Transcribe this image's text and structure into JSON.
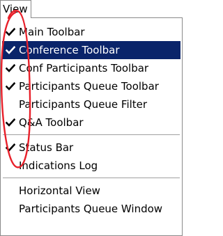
{
  "menu": {
    "title": "View",
    "sections": [
      [
        {
          "label": "Main Toolbar",
          "checked": true,
          "selected": false
        },
        {
          "label": "Conference Toolbar",
          "checked": true,
          "selected": true
        },
        {
          "label": "Conf Participants Toolbar",
          "checked": true,
          "selected": false
        },
        {
          "label": "Participants Queue Toolbar",
          "checked": true,
          "selected": false
        },
        {
          "label": "Participants Queue Filter",
          "checked": false,
          "selected": false
        },
        {
          "label": "Q&A Toolbar",
          "checked": true,
          "selected": false
        }
      ],
      [
        {
          "label": "Status Bar",
          "checked": true,
          "selected": false
        },
        {
          "label": "Indications Log",
          "checked": false,
          "selected": false
        }
      ],
      [
        {
          "label": "Horizontal View",
          "checked": false,
          "selected": false
        },
        {
          "label": "Participants Queue Window",
          "checked": false,
          "selected": false
        }
      ]
    ]
  },
  "colors": {
    "highlight": "#0a246a",
    "annotation": "#e8202a"
  },
  "icons": {
    "check": "checkmark-icon"
  }
}
